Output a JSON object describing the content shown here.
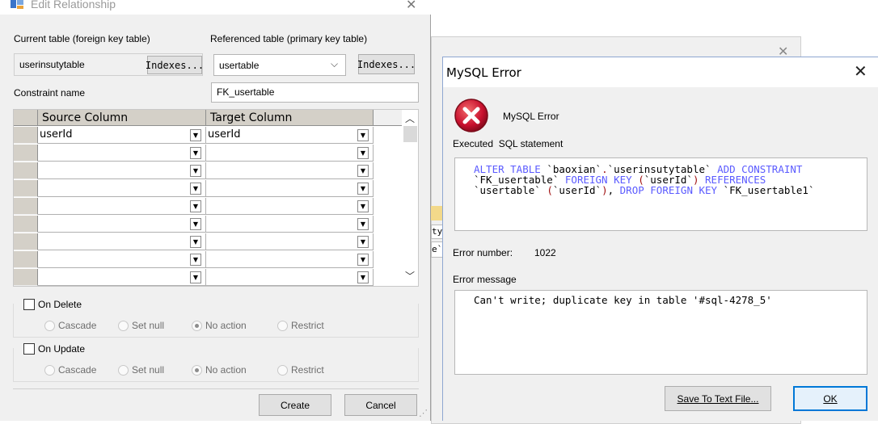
{
  "edit_relationship": {
    "title": "Edit Relationship",
    "current_table_label": "Current table (foreign key table)",
    "current_table_value": "userinsutytable",
    "referenced_table_label": "Referenced table (primary key table)",
    "referenced_table_value": "usertable",
    "indexes_label": "Indexes...",
    "constraint_name_label": "Constraint name",
    "constraint_name_value": "FK_usertable",
    "grid": {
      "headers": [
        "Source Column",
        "Target Column"
      ],
      "rows": [
        {
          "source": "userId",
          "target": "userId"
        },
        {
          "source": "",
          "target": ""
        },
        {
          "source": "",
          "target": ""
        },
        {
          "source": "",
          "target": ""
        },
        {
          "source": "",
          "target": ""
        },
        {
          "source": "",
          "target": ""
        },
        {
          "source": "",
          "target": ""
        },
        {
          "source": "",
          "target": ""
        },
        {
          "source": "",
          "target": ""
        }
      ]
    },
    "on_delete": {
      "label": "On Delete",
      "options": [
        "Cascade",
        "Set null",
        "No action",
        "Restrict"
      ],
      "selected": "No action"
    },
    "on_update": {
      "label": "On Update",
      "options": [
        "Cascade",
        "Set null",
        "No action",
        "Restrict"
      ],
      "selected": "No action"
    },
    "create_label": "Create",
    "cancel_label": "Cancel"
  },
  "background": {
    "cell_a": "ty",
    "cell_b": "e`"
  },
  "mysql_error": {
    "title": "MySQL Error",
    "heading": "MySQL Error",
    "executed_label": "Executed  SQL statement",
    "sql_lines": [
      "ALTER TABLE `baoxian`.`userinsutytable` ADD CONSTRAINT",
      "`FK_usertable` FOREIGN KEY (`userId`) REFERENCES",
      "`usertable` (`userId`), DROP FOREIGN KEY `FK_usertable1`"
    ],
    "error_number_label": "Error number:",
    "error_number_value": "1022",
    "error_message_label": "Error message",
    "error_message_value": "Can't write; duplicate key in table '#sql-4278_5'",
    "save_label": "Save To Text File...",
    "ok_label": "OK"
  },
  "colors": {
    "dialog_bg": "#f0f0f0",
    "sql_keyword": "#5b5bff",
    "sql_punct": "#a01010",
    "error_red": "#c8102e",
    "focus_border": "#0078d7"
  }
}
